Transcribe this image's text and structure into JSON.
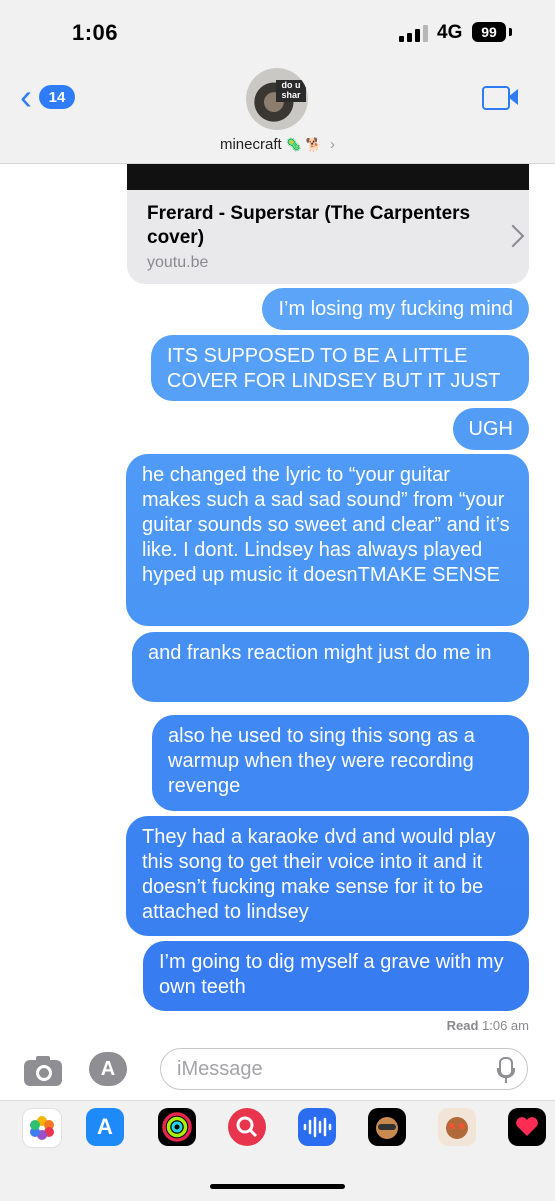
{
  "status_bar": {
    "time": "1:06",
    "network": "4G",
    "battery": "99"
  },
  "header": {
    "back_count": "14",
    "avatar_meme_text": "do u shar",
    "contact_name": "minecraft",
    "contact_suffix_glyphs": "🦠 🐕"
  },
  "link_preview": {
    "title": "Frerard - Superstar (The Carpenters cover)",
    "domain": "youtu.be"
  },
  "messages": [
    "I’m losing my fucking mind",
    "ITS SUPPOSED TO BE A LITTLE COVER FOR LINDSEY BUT IT JUST",
    "UGH",
    "he changed the lyric to “your guitar makes such a sad sad sound” from “your guitar sounds so sweet and clear” and it’s like. I dont. Lindsey has always played hyped up music it doesnTMAKE SENSE",
    "and franks reaction might just do me in",
    "also he used to sing this song as a warmup when they were recording revenge",
    "They had a karaoke dvd and would play this song to get their voice into it and it doesn’t fucking make sense for it to be attached to lindsey",
    "I’m going to dig myself a grave with my own teeth"
  ],
  "read_receipt": {
    "label": "Read",
    "time": "1:06 am"
  },
  "input": {
    "placeholder": "iMessage"
  },
  "colors": {
    "accent": "#2f7df6",
    "bubble_top": "#5aa3f7",
    "bubble_bottom": "#2f74ee"
  },
  "app_drawer": [
    "photos-icon",
    "appstore-icon",
    "activity-icon",
    "search-images-icon",
    "audio-icon",
    "memoji-icon",
    "memoji-stickers-icon",
    "digital-touch-icon"
  ]
}
